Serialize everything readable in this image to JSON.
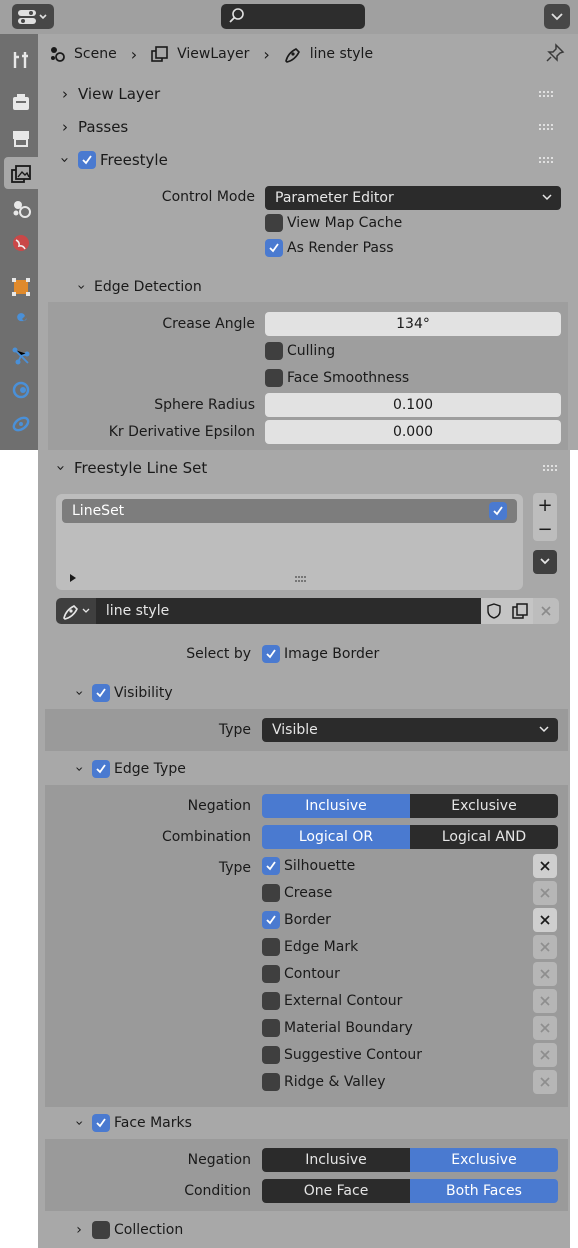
{
  "breadcrumb": {
    "scene": "Scene",
    "view_layer": "ViewLayer",
    "line_style": "line style"
  },
  "panels": {
    "view_layer": "View Layer",
    "passes": "Passes",
    "freestyle": "Freestyle"
  },
  "freestyle": {
    "control_mode_label": "Control Mode",
    "control_mode_value": "Parameter Editor",
    "view_map_cache": "View Map Cache",
    "as_render_pass": "As Render Pass"
  },
  "edge_detection": {
    "title": "Edge Detection",
    "crease_angle_label": "Crease Angle",
    "crease_angle_value": "134°",
    "culling": "Culling",
    "face_smoothness": "Face Smoothness",
    "sphere_radius_label": "Sphere Radius",
    "sphere_radius_value": "0.100",
    "kr_label": "Kr Derivative Epsilon",
    "kr_value": "0.000"
  },
  "line_set": {
    "title": "Freestyle Line Set",
    "item": "LineSet",
    "line_style": "line style",
    "select_by_label": "Select by",
    "image_border": "Image Border"
  },
  "visibility": {
    "title": "Visibility",
    "type_label": "Type",
    "type_value": "Visible"
  },
  "edge_type": {
    "title": "Edge Type",
    "negation_label": "Negation",
    "inclusive": "Inclusive",
    "exclusive": "Exclusive",
    "combination_label": "Combination",
    "logical_or": "Logical OR",
    "logical_and": "Logical AND",
    "type_label": "Type",
    "types": [
      {
        "label": "Silhouette",
        "checked": true
      },
      {
        "label": "Crease",
        "checked": false
      },
      {
        "label": "Border",
        "checked": true
      },
      {
        "label": "Edge Mark",
        "checked": false
      },
      {
        "label": "Contour",
        "checked": false
      },
      {
        "label": "External Contour",
        "checked": false
      },
      {
        "label": "Material Boundary",
        "checked": false
      },
      {
        "label": "Suggestive Contour",
        "checked": false
      },
      {
        "label": "Ridge & Valley",
        "checked": false
      }
    ]
  },
  "face_marks": {
    "title": "Face Marks",
    "negation_label": "Negation",
    "inclusive": "Inclusive",
    "exclusive": "Exclusive",
    "condition_label": "Condition",
    "one_face": "One Face",
    "both_faces": "Both Faces"
  },
  "collection": {
    "title": "Collection"
  },
  "colors": {
    "accent": "#4a7ad0",
    "panel": "#a8a8a8",
    "field_dark": "#2b2b2b"
  }
}
